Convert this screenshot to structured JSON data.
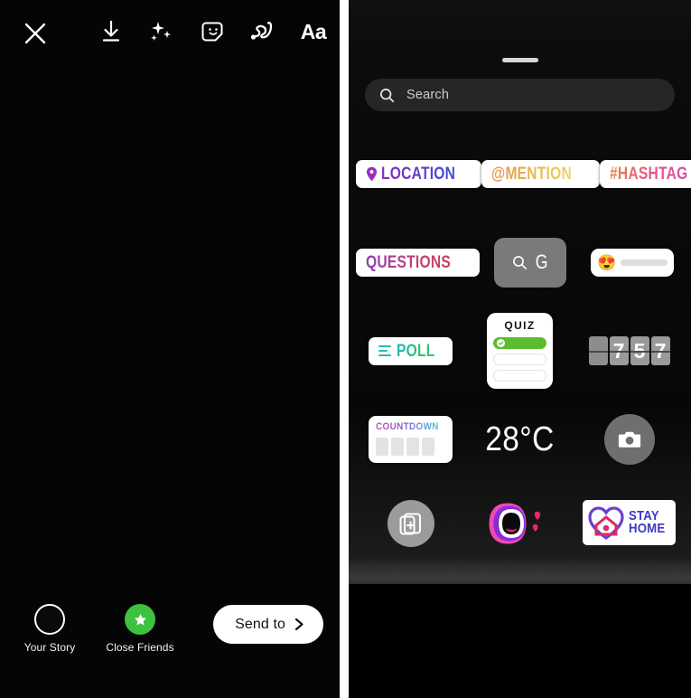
{
  "composer": {
    "close_icon": "close-icon",
    "tools": [
      {
        "name": "download-icon",
        "label": "Save"
      },
      {
        "name": "sparkles-icon",
        "label": "Effects"
      },
      {
        "name": "sticker-smiley-icon",
        "label": "Stickers"
      },
      {
        "name": "draw-squiggle-icon",
        "label": "Draw"
      },
      {
        "name": "text-icon",
        "label": "Aa"
      }
    ],
    "audience": [
      {
        "name": "your-story",
        "label": "Your Story",
        "style": "ring"
      },
      {
        "name": "close-friends",
        "label": "Close Friends",
        "style": "green-star",
        "color": "#3dc23f"
      }
    ],
    "send_to": {
      "label": "Send to",
      "chevron": "chevron-right-icon"
    }
  },
  "sticker_tray": {
    "grabber": "drag-handle",
    "search": {
      "placeholder": "Search",
      "icon": "search-icon"
    },
    "rows": [
      {
        "items": [
          {
            "type": "pill",
            "name": "location-sticker",
            "label": "LOCATION",
            "icon": "location-pin-icon",
            "gradient": "purple-to-blue"
          },
          {
            "type": "pill",
            "name": "mention-sticker",
            "label": "@MENTION",
            "gradient": "orange-to-yellow"
          },
          {
            "type": "pill",
            "name": "hashtag-sticker",
            "label": "#HASHTAG",
            "gradient": "orange-to-pink"
          }
        ]
      },
      {
        "items": [
          {
            "type": "pill",
            "name": "questions-sticker",
            "label": "QUESTIONS",
            "gradient": "purple-to-red"
          },
          {
            "type": "gif",
            "name": "gif-sticker",
            "label": "G",
            "icon": "search-icon"
          },
          {
            "type": "slider",
            "name": "emoji-slider-sticker",
            "emoji": "😍"
          }
        ]
      },
      {
        "items": [
          {
            "type": "pill",
            "name": "poll-sticker",
            "label": "POLL",
            "icon": "poll-bars-icon",
            "gradient": "teal-to-green"
          },
          {
            "type": "quiz",
            "name": "quiz-sticker",
            "title": "QUIZ",
            "options": 3,
            "correct_index": 0
          },
          {
            "type": "clock",
            "name": "countdown-clock-sticker",
            "digits": [
              "",
              "7",
              "5",
              "7"
            ]
          }
        ]
      },
      {
        "items": [
          {
            "type": "countdown",
            "name": "countdown-sticker",
            "label": "COUNTDOWN",
            "blocks": 4,
            "gradient": "pink-to-cyan"
          },
          {
            "type": "temp",
            "name": "temperature-sticker",
            "label": "28°C"
          },
          {
            "type": "camera",
            "name": "camera-sticker",
            "icon": "camera-icon"
          }
        ]
      },
      {
        "items": [
          {
            "type": "add-photo",
            "name": "add-photo-sticker",
            "icon": "add-photo-icon"
          },
          {
            "type": "mouth",
            "name": "mouth-gif-sticker",
            "icon": "mouth-hearts-icon"
          },
          {
            "type": "stayhome",
            "name": "stay-home-sticker",
            "label_line1": "STAY",
            "label_line2": "HOME",
            "icon": "heart-house-icon"
          }
        ]
      }
    ]
  },
  "colors": {
    "close_friends_green": "#3dc23f",
    "quiz_green": "#5bbd2e",
    "tray_background": "#0b0b0b",
    "search_background": "#262626"
  }
}
